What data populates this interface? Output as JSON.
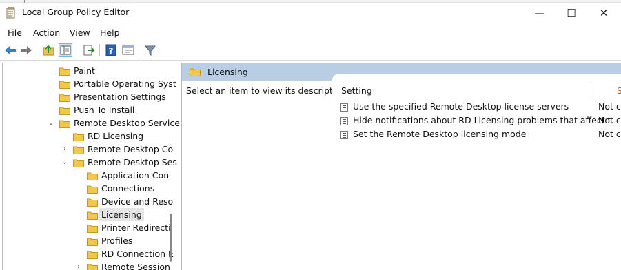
{
  "window": {
    "title": "Local Group Policy Editor"
  },
  "window_buttons": {
    "minimize": "—",
    "maximize": "☐",
    "close": "✕"
  },
  "menu": [
    "File",
    "Action",
    "View",
    "Help"
  ],
  "toolbar": [
    "back-icon",
    "forward-icon",
    "up-folder-icon",
    "show-hide-tree-icon",
    "export-list-icon",
    "help-icon",
    "properties-icon",
    "filter-icon"
  ],
  "tree": [
    {
      "label": "Paint",
      "twisty": "",
      "depth": 0
    },
    {
      "label": "Portable Operating Syst",
      "twisty": "",
      "depth": 0
    },
    {
      "label": "Presentation Settings",
      "twisty": "",
      "depth": 0
    },
    {
      "label": "Push To Install",
      "twisty": "",
      "depth": 0
    },
    {
      "label": "Remote Desktop Service",
      "twisty": "⌄",
      "depth": 0
    },
    {
      "label": "RD Licensing",
      "twisty": "",
      "depth": 1
    },
    {
      "label": "Remote Desktop Co",
      "twisty": "›",
      "depth": 1
    },
    {
      "label": "Remote Desktop Ses",
      "twisty": "⌄",
      "depth": 1
    },
    {
      "label": "Application Con",
      "twisty": "",
      "depth": 2
    },
    {
      "label": "Connections",
      "twisty": "",
      "depth": 2
    },
    {
      "label": "Device and Reso",
      "twisty": "",
      "depth": 2
    },
    {
      "label": "Licensing",
      "twisty": "",
      "depth": 2,
      "selected": true
    },
    {
      "label": "Printer Redirecti",
      "twisty": "",
      "depth": 2
    },
    {
      "label": "Profiles",
      "twisty": "",
      "depth": 2
    },
    {
      "label": "RD Connection E",
      "twisty": "",
      "depth": 2
    },
    {
      "label": "Remote Session",
      "twisty": "›",
      "depth": 2
    }
  ],
  "right": {
    "title": "Licensing",
    "description": "Select an item to view its description.",
    "column_setting": "Setting",
    "column_state": "S",
    "settings": [
      {
        "name": "Use the specified Remote Desktop license servers",
        "state": "Not c"
      },
      {
        "name": "Hide notifications about RD Licensing problems that affect t...",
        "state": "Not c"
      },
      {
        "name": "Set the Remote Desktop licensing mode",
        "state": "Not c"
      }
    ]
  },
  "colors": {
    "header_blue": "#b9cde5",
    "folder_yellow": "#f3c74a",
    "state_orange": "#b5651d"
  }
}
